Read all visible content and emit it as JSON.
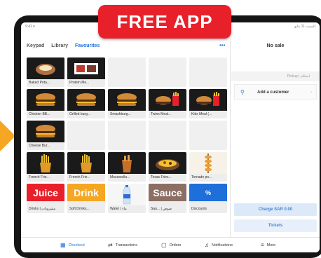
{
  "badge": {
    "text": "FREE APP"
  },
  "statusbar": {
    "left": "9:41 ▾",
    "right": "السبت 11 مايو"
  },
  "tabs": [
    {
      "label": "Keypad",
      "active": false
    },
    {
      "label": "Library",
      "active": false
    },
    {
      "label": "Favourites",
      "active": true
    }
  ],
  "more_icon": "more-icon",
  "grid": {
    "rows": [
      [
        {
          "label": "Baked Pota...",
          "kind": "photo",
          "icon": "potato-icon"
        },
        {
          "label": "Protein Me...",
          "kind": "photo",
          "icon": "meal-box-icon"
        },
        {
          "kind": "empty"
        },
        {
          "kind": "empty"
        },
        {
          "kind": "empty"
        }
      ],
      [
        {
          "label": "Chicken BB...",
          "kind": "photo",
          "icon": "burger-icon"
        },
        {
          "label": "Grilled burg...",
          "kind": "photo",
          "icon": "burger-icon"
        },
        {
          "label": "Smashburg...",
          "kind": "photo",
          "icon": "burger-icon"
        },
        {
          "label": "Twins Meal...",
          "kind": "photo",
          "icon": "meal-icon"
        },
        {
          "label": "Kids Meal (...",
          "kind": "photo",
          "icon": "meal-icon"
        }
      ],
      [
        {
          "label": "Cheese Bur...",
          "kind": "photo",
          "icon": "burger-icon"
        },
        {
          "kind": "empty"
        },
        {
          "kind": "empty"
        },
        {
          "kind": "empty"
        },
        {
          "kind": "empty"
        }
      ],
      [
        {
          "label": "French Frie...",
          "kind": "photo",
          "icon": "fries-icon"
        },
        {
          "label": "French Frie...",
          "kind": "photo",
          "icon": "fries-icon"
        },
        {
          "label": "Mozzarella...",
          "kind": "photo",
          "icon": "sticks-icon"
        },
        {
          "label": "Texas Fries...",
          "kind": "photo",
          "icon": "loaded-fries-icon"
        },
        {
          "label": "Tornado po...",
          "kind": "photo-light",
          "icon": "tornado-potato-icon"
        }
      ],
      [
        {
          "label": "Drinks | مشروبات",
          "kind": "color",
          "text": "Juice",
          "color": "#e8202a"
        },
        {
          "label": "Soft Drinks...",
          "kind": "color",
          "text": "Drink",
          "color": "#f5a623"
        },
        {
          "label": "Water | ماء",
          "kind": "water",
          "icon": "water-bottle-icon"
        },
        {
          "label": "Sau... | صوص",
          "kind": "color",
          "text": "Sauce",
          "color": "#8d6e63"
        },
        {
          "label": "Discounts",
          "kind": "color",
          "text": "%",
          "color": "#1e6fd9",
          "icon": "discount-icon"
        }
      ]
    ]
  },
  "right": {
    "title": "No sale",
    "subtitle": "Pickup | استلام",
    "customer_label": "Add a customer",
    "charge_label": "Charge SAR 0.00",
    "tickets_label": "Tickets"
  },
  "bottom_nav": [
    {
      "label": "Checkout",
      "icon": "grid-icon",
      "glyph": "▦",
      "active": true
    },
    {
      "label": "Transactions",
      "icon": "transactions-icon",
      "glyph": "⇄",
      "active": false
    },
    {
      "label": "Orders",
      "icon": "orders-icon",
      "glyph": "▢",
      "active": false
    },
    {
      "label": "Notifications",
      "icon": "bell-icon",
      "glyph": "♫",
      "active": false
    },
    {
      "label": "More",
      "icon": "menu-icon",
      "glyph": "≡",
      "active": false
    }
  ],
  "colors": {
    "accent": "#1e6fd9",
    "badge": "#e8202a",
    "arrow": "#f5a623"
  }
}
